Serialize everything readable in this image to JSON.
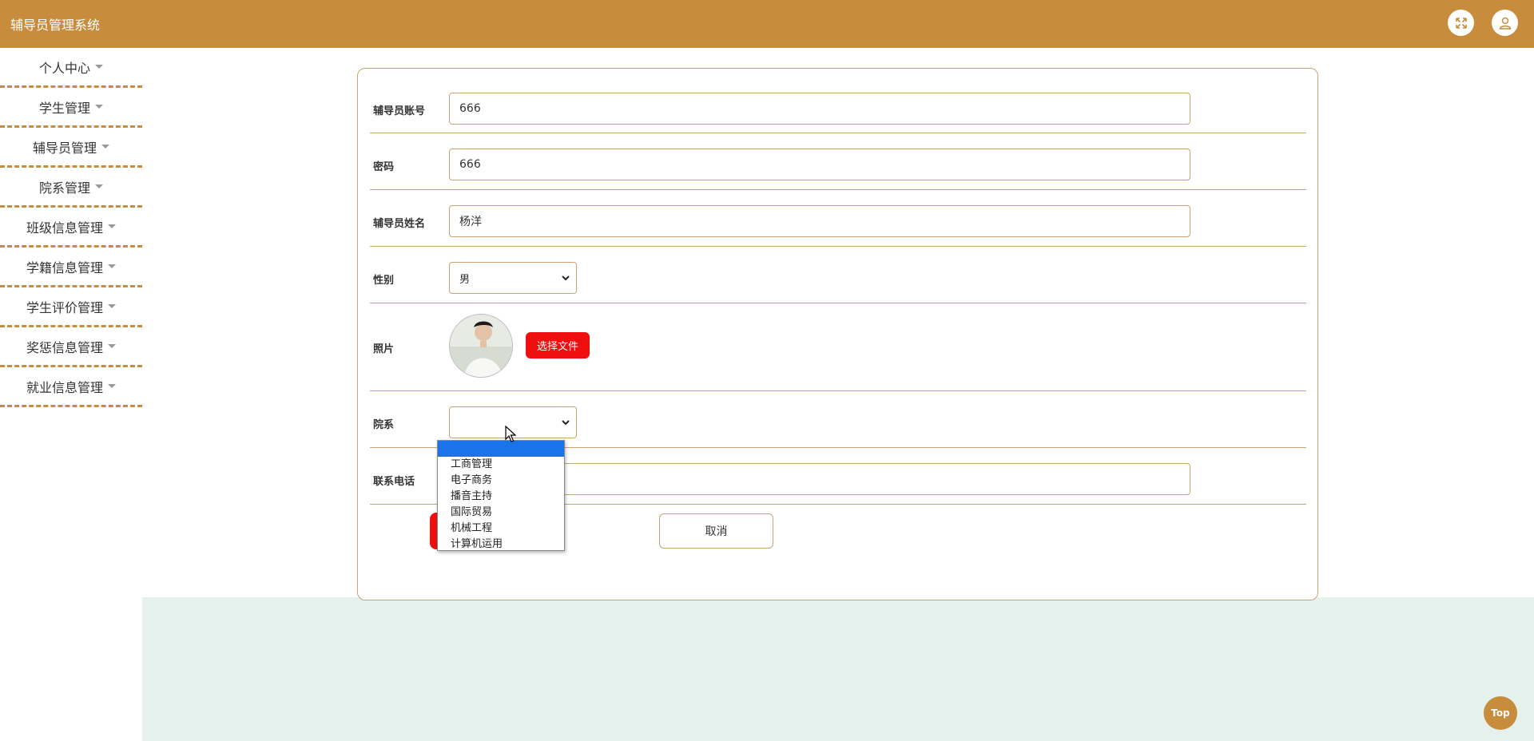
{
  "header": {
    "title": "辅导员管理系统"
  },
  "sidebar": {
    "items": [
      {
        "label": "个人中心"
      },
      {
        "label": "学生管理"
      },
      {
        "label": "辅导员管理"
      },
      {
        "label": "院系管理"
      },
      {
        "label": "班级信息管理"
      },
      {
        "label": "学籍信息管理"
      },
      {
        "label": "学生评价管理"
      },
      {
        "label": "奖惩信息管理"
      },
      {
        "label": "就业信息管理"
      }
    ]
  },
  "form": {
    "account": {
      "label": "辅导员账号",
      "value": "666"
    },
    "password": {
      "label": "密码",
      "value": "666"
    },
    "name": {
      "label": "辅导员姓名",
      "value": "杨洋"
    },
    "gender": {
      "label": "性别",
      "value": "男"
    },
    "photo": {
      "label": "照片",
      "button": "选择文件"
    },
    "department": {
      "label": "院系",
      "value": "",
      "options": [
        "",
        "工商管理",
        "电子商务",
        "播音主持",
        "国际贸易",
        "机械工程",
        "计算机运用"
      ]
    },
    "phone": {
      "label": "联系电话",
      "value": ""
    },
    "cancel_label": "取消"
  },
  "fab": {
    "top_label": "Top"
  },
  "colors": {
    "primary": "#c78c3c",
    "danger": "#f00f0f",
    "border": "#c7a472",
    "bottom_bg": "#e4f1ec",
    "selected_option": "#1a73e8"
  },
  "icons": {
    "fullscreen": "expand-icon",
    "user": "user-icon"
  }
}
